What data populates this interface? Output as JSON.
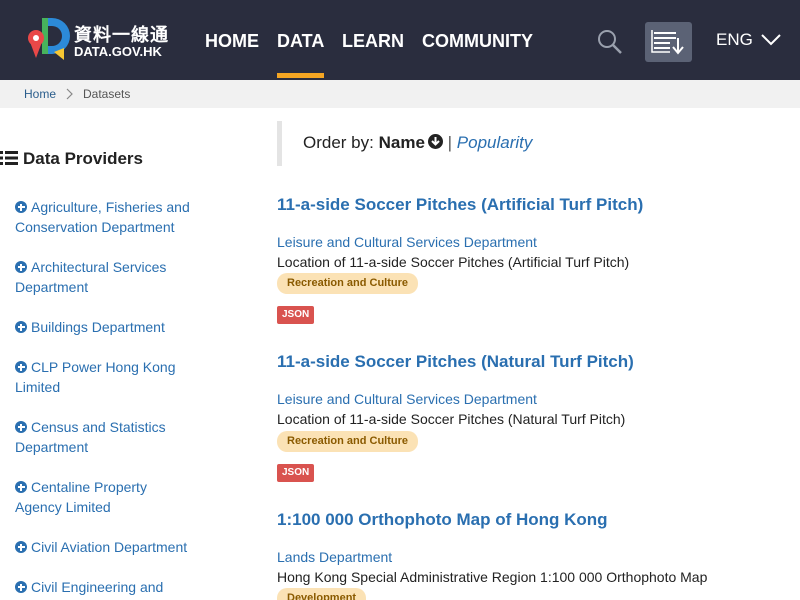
{
  "header": {
    "logo_cn": "資料一線通",
    "logo_en": "DATA.GOV.HK",
    "nav": [
      "HOME",
      "DATA",
      "LEARN",
      "COMMUNITY"
    ],
    "active_nav": "DATA",
    "language": "ENG",
    "icons": {
      "search": "search-icon",
      "download_list": "download-list-icon",
      "chevron": "chevron-down-icon"
    },
    "colors": {
      "background": "#2a2d3e",
      "active_underline": "#f5a623"
    }
  },
  "breadcrumb": {
    "home": "Home",
    "current": "Datasets"
  },
  "sidebar": {
    "title": "Data Providers",
    "providers": [
      [
        "Agriculture, Fisheries and",
        "Conservation Department"
      ],
      [
        "Architectural Services",
        "Department"
      ],
      [
        "Buildings Department"
      ],
      [
        "CLP Power Hong Kong",
        "Limited"
      ],
      [
        "Census and Statistics",
        "Department"
      ],
      [
        "Centaline Property",
        "Agency Limited"
      ],
      [
        "Civil Aviation Department"
      ],
      [
        "Civil Engineering and"
      ]
    ]
  },
  "order": {
    "label": "Order by:",
    "name": "Name",
    "separator": "|",
    "popularity": "Popularity"
  },
  "datasets": [
    {
      "title": "11-a-side Soccer Pitches (Artificial Turf Pitch)",
      "department": "Leisure and Cultural Services Department",
      "description": "Location of 11-a-side Soccer Pitches (Artificial Turf Pitch)",
      "category": "Recreation and Culture",
      "format": "JSON"
    },
    {
      "title": "11-a-side Soccer Pitches (Natural Turf Pitch)",
      "department": "Leisure and Cultural Services Department",
      "description": "Location of 11-a-side Soccer Pitches (Natural Turf Pitch)",
      "category": "Recreation and Culture",
      "format": "JSON"
    },
    {
      "title": "1:100 000 Orthophoto Map of Hong Kong",
      "department": "Lands Department",
      "description": "Hong Kong Special Administrative Region 1:100 000 Orthophoto Map",
      "category": "Development"
    }
  ],
  "colors": {
    "link": "#2a6fb0",
    "category_badge": "#fbe2b5",
    "format_badge": "#d9534f"
  }
}
